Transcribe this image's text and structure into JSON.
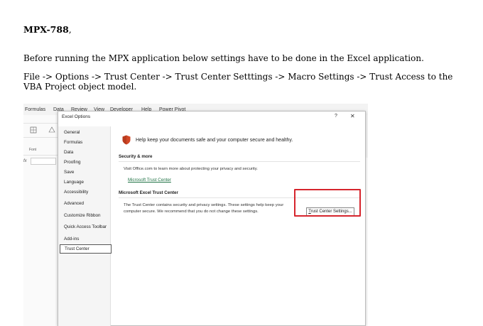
{
  "document": {
    "heading": "MPX-788",
    "heading_suffix": ",",
    "paragraph1": "Before running the MPX application below settings have to be done in the Excel application.",
    "paragraph2": "File -> Options -> Trust Center -> Trust Center Setttings -> Macro Settings -> Trust Access to the VBA Project object model."
  },
  "excel_ribbon": {
    "tabs": [
      "Formulas",
      "Data",
      "Review",
      "View",
      "Developer",
      "Help",
      "Power Pivot"
    ],
    "font_group_label": "Font",
    "formula_prefix": "fx"
  },
  "dialog": {
    "title": "Excel Options",
    "help_label": "?",
    "close_label": "✕",
    "nav_items": [
      "General",
      "Formulas",
      "Data",
      "Proofing",
      "Save",
      "Language",
      "Accessibility",
      "Advanced",
      "Customize Ribbon",
      "Quick Access Toolbar",
      "Add-ins",
      "Trust Center"
    ],
    "selected_nav": "Trust Center",
    "content": {
      "intro": "Help keep your documents safe and your computer secure and healthy.",
      "security_heading": "Security & more",
      "security_text": "Visit Office.com to learn more about protecting your privacy and security.",
      "trust_link": "Microsoft Trust Center",
      "tc_heading": "Microsoft Excel Trust Center",
      "tc_text1": "The Trust Center contains security and privacy settings. These settings help keep your",
      "tc_text2": "computer secure. We recommend that you do not change these settings.",
      "tc_button": "Trust Center Settings..."
    }
  },
  "colors": {
    "highlight": "#d6252d",
    "link": "#217346",
    "shield": "#d24726"
  }
}
